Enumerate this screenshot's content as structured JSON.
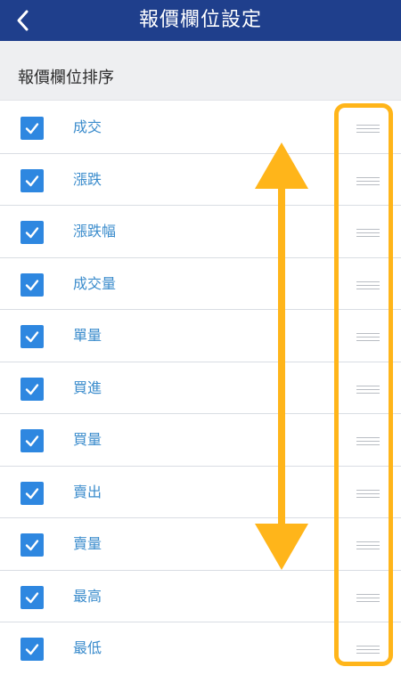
{
  "header": {
    "title": "報價欄位設定",
    "back_icon": "chevron-left-icon"
  },
  "section": {
    "title": "報價欄位排序"
  },
  "rows": [
    {
      "label": "成交",
      "checked": true
    },
    {
      "label": "漲跌",
      "checked": true
    },
    {
      "label": "漲跌幅",
      "checked": true
    },
    {
      "label": "成交量",
      "checked": true
    },
    {
      "label": "單量",
      "checked": true
    },
    {
      "label": "買進",
      "checked": true
    },
    {
      "label": "買量",
      "checked": true
    },
    {
      "label": "賣出",
      "checked": true
    },
    {
      "label": "賣量",
      "checked": true
    },
    {
      "label": "最高",
      "checked": true
    },
    {
      "label": "最低",
      "checked": true
    }
  ],
  "colors": {
    "header_bg": "#1f3f8c",
    "checkbox": "#2e87e0",
    "label": "#3b8ccc",
    "annotation": "#ffb51a"
  },
  "annotations": {
    "vertical_arrow_icon": "up-down-arrow-icon",
    "handle_icon": "drag-handle-icon"
  }
}
